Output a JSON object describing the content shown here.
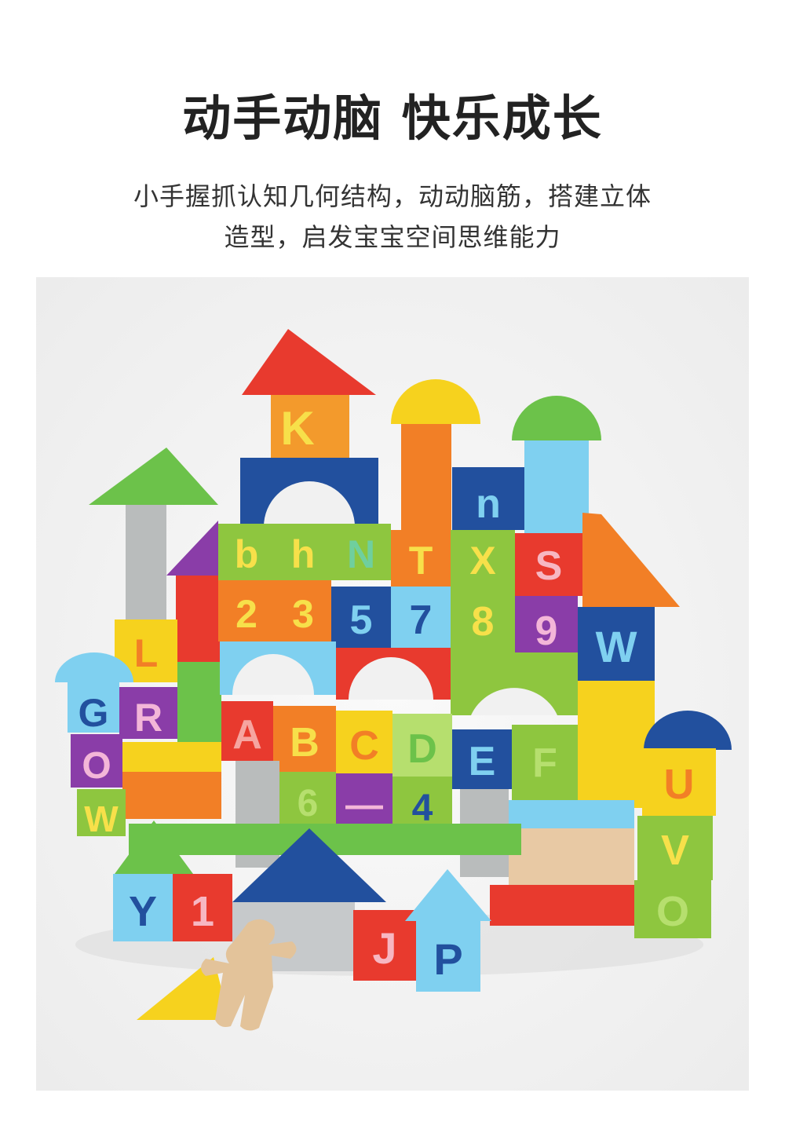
{
  "heading": "动手动脑 快乐成长",
  "description": {
    "line1": "小手握抓认知几何结构，动动脑筋，搭建立体",
    "line2": "造型，启发宝宝空间思维能力"
  },
  "photo": {
    "subject": "wooden-letter-number-blocks-castle",
    "block_labels": {
      "k": "K",
      "n": "n",
      "b": "b",
      "h": "h",
      "nN": "N",
      "t": "T",
      "x": "X",
      "s": "S",
      "d2": "2",
      "d3": "3",
      "d5": "5",
      "d7": "7",
      "d8": "8",
      "d9": "9",
      "w1": "W",
      "l": "L",
      "g": "G",
      "r": "R",
      "o1": "O",
      "w2": "W",
      "a": "A",
      "bB": "B",
      "c": "C",
      "dD": "D",
      "e": "E",
      "f": "F",
      "d6": "6",
      "minus": "—",
      "d4": "4",
      "u": "U",
      "v": "V",
      "o2": "O",
      "y": "Y",
      "d1": "1",
      "j": "J",
      "p": "P"
    }
  }
}
